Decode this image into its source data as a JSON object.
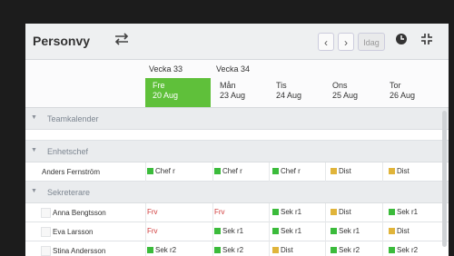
{
  "header": {
    "title": "Personvy",
    "today_label": "Idag"
  },
  "weeks": [
    {
      "label": "Vecka 33"
    },
    {
      "label": "Vecka 34"
    }
  ],
  "days": [
    {
      "dow": "Fre",
      "date": "20 Aug",
      "today": true
    },
    {
      "dow": "Mån",
      "date": "23 Aug"
    },
    {
      "dow": "Tis",
      "date": "24 Aug"
    },
    {
      "dow": "Ons",
      "date": "25 Aug"
    },
    {
      "dow": "Tor",
      "date": "26 Aug"
    }
  ],
  "sections": {
    "teamkalender": "Teamkalender",
    "enhetschef": "Enhetschef",
    "sekreterare": "Sekreterare"
  },
  "colors": {
    "today": "#5fc03a",
    "green": "#3bbb3b",
    "yellow": "#e0b43a",
    "frv": "#d13b3b"
  },
  "people": {
    "anders": {
      "name": "Anders Fernström",
      "cells": [
        {
          "text": "Chef r",
          "color": "green"
        },
        {
          "text": "Chef r",
          "color": "green"
        },
        {
          "text": "Chef r",
          "color": "green"
        },
        {
          "text": "Dist",
          "color": "yellow"
        },
        {
          "text": "Dist",
          "color": "yellow"
        }
      ]
    },
    "anna": {
      "name": "Anna Bengtsson",
      "cells": [
        {
          "text": "Frv",
          "color": "none"
        },
        {
          "text": "Frv",
          "color": "none"
        },
        {
          "text": "Sek r1",
          "color": "green"
        },
        {
          "text": "Dist",
          "color": "yellow"
        },
        {
          "text": "Sek r1",
          "color": "green"
        }
      ]
    },
    "eva": {
      "name": "Eva Larsson",
      "cells": [
        {
          "text": "Frv",
          "color": "none"
        },
        {
          "text": "Sek r1",
          "color": "green"
        },
        {
          "text": "Sek r1",
          "color": "green"
        },
        {
          "text": "Sek r1",
          "color": "green"
        },
        {
          "text": "Dist",
          "color": "yellow"
        }
      ]
    },
    "stina": {
      "name": "Stina Andersson",
      "cells": [
        {
          "text": "Sek r2",
          "color": "green"
        },
        {
          "text": "Sek r2",
          "color": "green"
        },
        {
          "text": "Dist",
          "color": "yellow"
        },
        {
          "text": "Sek r2",
          "color": "green"
        },
        {
          "text": "Sek r2",
          "color": "green"
        }
      ]
    }
  }
}
